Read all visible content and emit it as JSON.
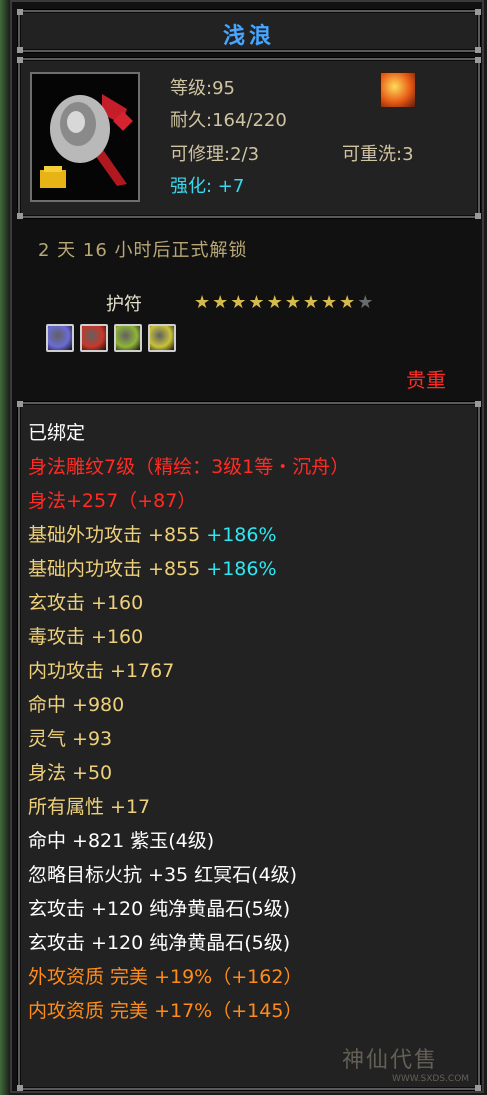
{
  "item": {
    "name": "浅浪",
    "level_line": "等级:95",
    "durability_line": "耐久:164/220",
    "repair_line": "可修理:2/3",
    "rewash_line": "可重洗:3",
    "strengthen_line": "强化: +7",
    "unlock_text": "2 天 16 小时后正式解锁",
    "category_label": "护符",
    "stars": {
      "filled": 9,
      "total": 10
    },
    "valuable_label": "贵重",
    "icon": "amulet-pendant-icon",
    "fire_icon": "fire-element-icon"
  },
  "attributes": [
    {
      "segments": [
        {
          "text": "已绑定",
          "color": "#ffffff"
        }
      ]
    },
    {
      "segments": [
        {
          "text": "身法雕纹7级（精绘：3级1等・沉舟）",
          "color": "#ff2b24"
        }
      ]
    },
    {
      "segments": [
        {
          "text": "身法+257（+87）",
          "color": "#ff2b24"
        }
      ]
    },
    {
      "segments": [
        {
          "text": "基础外功攻击 +855",
          "color": "#eed07a"
        },
        {
          "text": " +186%",
          "color": "#2ee7f2"
        }
      ]
    },
    {
      "segments": [
        {
          "text": "基础内功攻击 +855",
          "color": "#eed07a"
        },
        {
          "text": " +186%",
          "color": "#2ee7f2"
        }
      ]
    },
    {
      "segments": [
        {
          "text": "玄攻击 +160",
          "color": "#eed07a"
        }
      ]
    },
    {
      "segments": [
        {
          "text": "毒攻击 +160",
          "color": "#eed07a"
        }
      ]
    },
    {
      "segments": [
        {
          "text": "内功攻击 +1767",
          "color": "#eed07a"
        }
      ]
    },
    {
      "segments": [
        {
          "text": "命中 +980",
          "color": "#eed07a"
        }
      ]
    },
    {
      "segments": [
        {
          "text": "灵气 +93",
          "color": "#eed07a"
        }
      ]
    },
    {
      "segments": [
        {
          "text": "身法 +50",
          "color": "#eed07a"
        }
      ]
    },
    {
      "segments": [
        {
          "text": "所有属性 +17",
          "color": "#eed07a"
        }
      ]
    },
    {
      "segments": [
        {
          "text": "命中 +821 紫玉(4级)",
          "color": "#ffffff"
        }
      ]
    },
    {
      "segments": [
        {
          "text": "忽略目标火抗 +35 红冥石(4级)",
          "color": "#ffffff"
        }
      ]
    },
    {
      "segments": [
        {
          "text": "玄攻击 +120 纯净黄晶石(5级)",
          "color": "#ffffff"
        }
      ]
    },
    {
      "segments": [
        {
          "text": "玄攻击 +120 纯净黄晶石(5级)",
          "color": "#ffffff"
        }
      ]
    },
    {
      "segments": [
        {
          "text": "外攻资质  完美 +19%（+162）",
          "color": "#ff8c1a"
        }
      ]
    },
    {
      "segments": [
        {
          "text": "内攻资质  完美 +17%（+145）",
          "color": "#ff8c1a"
        }
      ]
    }
  ],
  "gems": [
    {
      "name": "purple-gem-icon",
      "color": "#6b6bd6"
    },
    {
      "name": "red-gem-icon",
      "color": "#c8382a"
    },
    {
      "name": "yellow-green-gem-icon",
      "color": "#8fb43a"
    },
    {
      "name": "yellow-gem-icon",
      "color": "#c9c23a"
    }
  ],
  "watermark": {
    "text": "神仙代售",
    "url": "WWW.SXDS.COM"
  }
}
